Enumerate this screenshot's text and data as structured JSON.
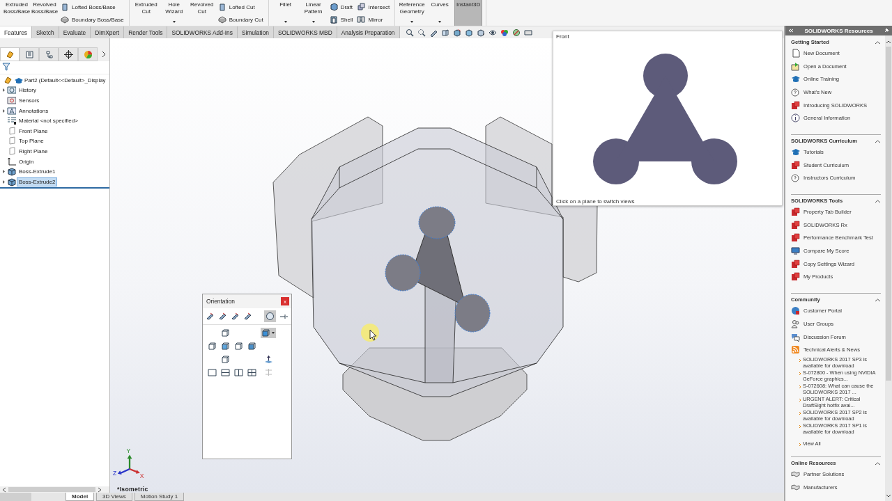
{
  "ribbon": {
    "groups": [
      {
        "items": [
          {
            "kind": "large",
            "label": "Extruded Boss/Base",
            "dropdown": false,
            "selected": false
          },
          {
            "kind": "large",
            "label": "Revolved Boss/Base",
            "dropdown": false,
            "selected": false
          },
          {
            "kind": "stack",
            "items": [
              {
                "label": "Lofted Boss/Base"
              },
              {
                "label": "Boundary Boss/Base"
              }
            ]
          }
        ]
      },
      {
        "items": [
          {
            "kind": "large",
            "label": "Extruded Cut",
            "dropdown": false,
            "selected": false
          },
          {
            "kind": "large",
            "label": "Hole Wizard",
            "dropdown": true,
            "selected": false
          },
          {
            "kind": "large",
            "label": "Revolved Cut",
            "dropdown": false,
            "selected": false
          },
          {
            "kind": "stack",
            "items": [
              {
                "label": "Lofted Cut"
              },
              {
                "label": "Boundary Cut"
              }
            ]
          }
        ]
      },
      {
        "items": [
          {
            "kind": "large",
            "label": "Fillet",
            "dropdown": true,
            "selected": false
          },
          {
            "kind": "large",
            "label": "Linear Pattern",
            "dropdown": true,
            "selected": false
          },
          {
            "kind": "stack",
            "items": [
              {
                "label": "Draft"
              },
              {
                "label": "Shell"
              }
            ]
          },
          {
            "kind": "stack",
            "items": [
              {
                "label": "Intersect"
              },
              {
                "label": "Mirror"
              }
            ]
          }
        ]
      },
      {
        "items": [
          {
            "kind": "large",
            "label": "Reference Geometry",
            "dropdown": true,
            "selected": false
          },
          {
            "kind": "large",
            "label": "Curves",
            "dropdown": true,
            "selected": false
          },
          {
            "kind": "large",
            "label": "Instant3D",
            "dropdown": false,
            "selected": true
          }
        ]
      }
    ]
  },
  "tabs": [
    {
      "label": "Features",
      "selected": true
    },
    {
      "label": "Sketch",
      "selected": false
    },
    {
      "label": "Evaluate",
      "selected": false
    },
    {
      "label": "DimXpert",
      "selected": false
    },
    {
      "label": "Render Tools",
      "selected": false
    },
    {
      "label": "SOLIDWORKS Add-Ins",
      "selected": false
    },
    {
      "label": "Simulation",
      "selected": false
    },
    {
      "label": "SOLIDWORKS MBD",
      "selected": false
    },
    {
      "label": "Analysis Preparation",
      "selected": false
    }
  ],
  "feature_tree": {
    "items": [
      {
        "label": "Part2  (Default<<Default>_Display",
        "kind": "part",
        "collapsed": false,
        "selected": false,
        "children": [
          {
            "label": "History",
            "kind": "history",
            "collapsed": true,
            "selected": false
          },
          {
            "label": "Sensors",
            "kind": "sensors",
            "collapsed": false,
            "selected": false
          },
          {
            "label": "Annotations",
            "kind": "annotations",
            "collapsed": true,
            "selected": false
          },
          {
            "label": "Material <not specified>",
            "kind": "material",
            "collapsed": false,
            "selected": false
          },
          {
            "label": "Front Plane",
            "kind": "plane",
            "collapsed": false,
            "selected": false
          },
          {
            "label": "Top Plane",
            "kind": "plane",
            "collapsed": false,
            "selected": false
          },
          {
            "label": "Right Plane",
            "kind": "plane",
            "collapsed": false,
            "selected": false
          },
          {
            "label": "Origin",
            "kind": "origin",
            "collapsed": false,
            "selected": false
          },
          {
            "label": "Boss-Extrude1",
            "kind": "feature",
            "collapsed": true,
            "selected": false
          },
          {
            "label": "Boss-Extrude2",
            "kind": "feature",
            "collapsed": true,
            "selected": true
          }
        ]
      }
    ]
  },
  "front_view": {
    "title": "Front",
    "caption": "Click on a plane to switch views"
  },
  "orientation": {
    "title": "Orientation",
    "close": "x"
  },
  "triad": {
    "x": "X",
    "y": "Y",
    "z": "Z"
  },
  "view_name": "*Isometric",
  "bottom_tabs": [
    {
      "label": "Model",
      "selected": true
    },
    {
      "label": "3D Views",
      "selected": false
    },
    {
      "label": "Motion Study 1",
      "selected": false
    }
  ],
  "task_pane": {
    "title": "SOLIDWORKS Resources",
    "sections": [
      {
        "title": "Getting Started",
        "items": [
          {
            "label": "New Document",
            "kind": "document"
          },
          {
            "label": "Open a Document",
            "kind": "open"
          },
          {
            "label": "Online Training",
            "kind": "cap"
          },
          {
            "label": "What's New",
            "kind": "question"
          },
          {
            "label": "Introducing SOLIDWORKS",
            "kind": "logo"
          },
          {
            "label": "General Information",
            "kind": "info"
          }
        ]
      },
      {
        "title": "SOLIDWORKS Curriculum",
        "items": [
          {
            "label": "Tutorials",
            "kind": "cap"
          },
          {
            "label": "Student Curriculum",
            "kind": "logo"
          },
          {
            "label": "Instructors Curriculum",
            "kind": "question"
          }
        ]
      },
      {
        "title": "SOLIDWORKS Tools",
        "items": [
          {
            "label": "Property Tab Builder",
            "kind": "logo"
          },
          {
            "label": "SOLIDWORKS Rx",
            "kind": "logo"
          },
          {
            "label": "Performance Benchmark Test",
            "kind": "logo"
          },
          {
            "label": "Compare My Score",
            "kind": "monitor"
          },
          {
            "label": "Copy Settings Wizard",
            "kind": "logo"
          },
          {
            "label": "My Products",
            "kind": "logo"
          }
        ]
      },
      {
        "title": "Community",
        "items": [
          {
            "label": "Customer Portal",
            "kind": "globe"
          },
          {
            "label": "User Groups",
            "kind": "users"
          },
          {
            "label": "Discussion Forum",
            "kind": "forum"
          },
          {
            "label": "Technical Alerts & News",
            "kind": "rss"
          },
          {
            "label": "SOLIDWORKS 2017 SP3 is available for download",
            "kind": "news"
          },
          {
            "label": "S-072800 - When using NVIDIA GeForce graphics...",
            "kind": "news"
          },
          {
            "label": "S-072608: What can cause the SOLIDWORKS 2017 ...",
            "kind": "news"
          },
          {
            "label": "URGENT ALERT: Critical DraftSight hotfix avai...",
            "kind": "news"
          },
          {
            "label": "SOLIDWORKS 2017 SP2 is available for download",
            "kind": "news"
          },
          {
            "label": "SOLIDWORKS 2017 SP1 is available for download",
            "kind": "news"
          },
          {
            "label": "View All",
            "kind": "more"
          }
        ]
      },
      {
        "title": "Online Resources",
        "items": [
          {
            "label": "Partner Solutions",
            "kind": "handshake"
          },
          {
            "label": "Manufacturers",
            "kind": "handshake"
          }
        ]
      }
    ]
  }
}
